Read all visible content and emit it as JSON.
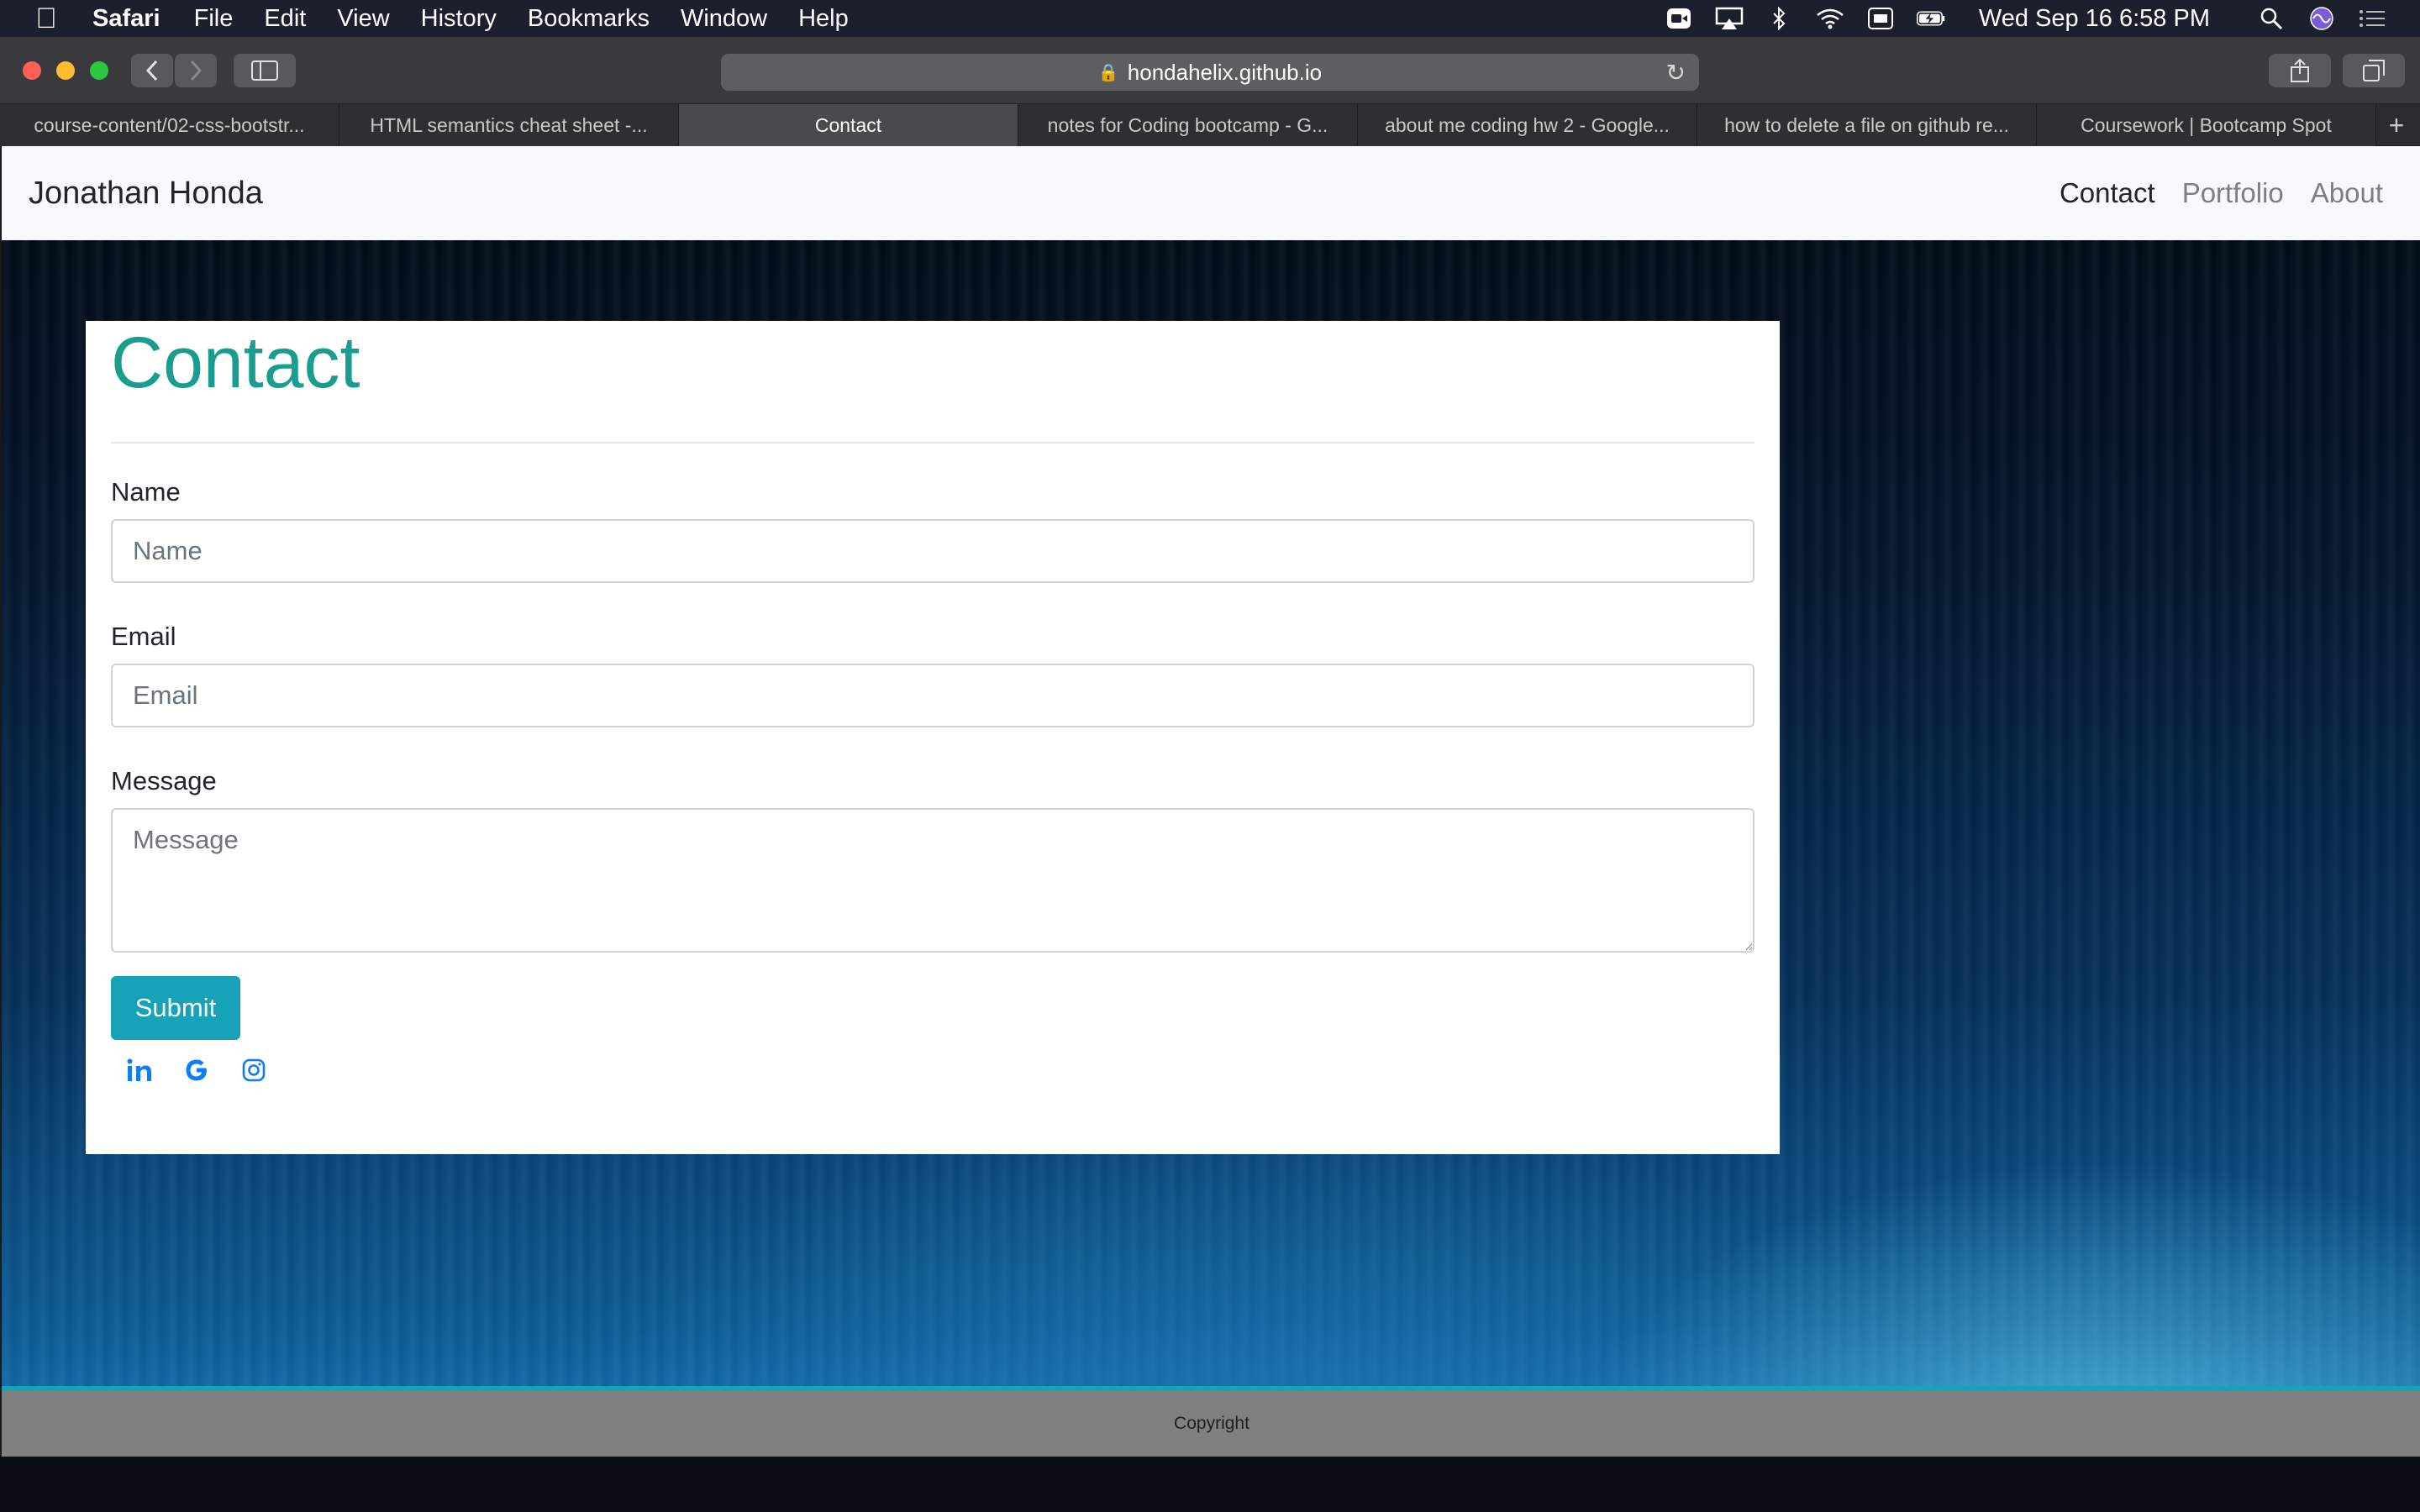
{
  "menubar": {
    "app": "Safari",
    "items": [
      "File",
      "Edit",
      "View",
      "History",
      "Bookmarks",
      "Window",
      "Help"
    ],
    "clock": "Wed Sep 16  6:58 PM"
  },
  "browser": {
    "url": "hondahelix.github.io",
    "tabs": [
      "course-content/02-css-bootstr...",
      "HTML semantics cheat sheet -...",
      "Contact",
      "notes for Coding bootcamp - G...",
      "about me coding hw 2 - Google...",
      "how to delete a file on github re...",
      "Coursework | Bootcamp Spot"
    ],
    "active_tab": 2
  },
  "site": {
    "brand": "Jonathan Honda",
    "nav": [
      "Contact",
      "Portfolio",
      "About"
    ]
  },
  "form": {
    "title": "Contact",
    "name_label": "Name",
    "name_placeholder": "Name",
    "email_label": "Email",
    "email_placeholder": "Email",
    "message_label": "Message",
    "message_placeholder": "Message",
    "submit_label": "Submit"
  },
  "social": [
    "linkedin-icon",
    "google-icon",
    "instagram-icon"
  ],
  "footer": {
    "text": "Copyright"
  },
  "colors": {
    "accent": "#1a9d8f",
    "button": "#17a2b8",
    "social": "#0d7ef5"
  }
}
